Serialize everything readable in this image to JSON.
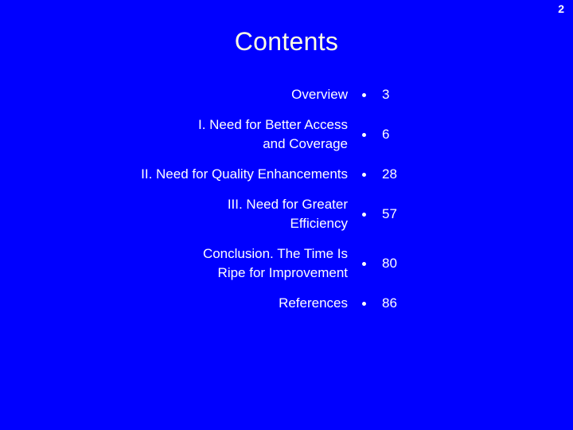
{
  "slide": {
    "number": "2",
    "title": "Contents",
    "background_color": "#0000FF",
    "title_color": "#FFFFE4",
    "text_color": "#FFFFFF"
  },
  "toc": {
    "entries": [
      {
        "label": "Overview",
        "page": "3",
        "lines": 1
      },
      {
        "label": "I. Need for Better Access and Coverage",
        "page": "6",
        "lines": 2
      },
      {
        "label": "II. Need for Quality Enhancements",
        "page": "28",
        "lines": 1
      },
      {
        "label": "III. Need for Greater Efficiency",
        "page": "57",
        "lines": 2
      },
      {
        "label": "Conclusion. The Time Is Ripe for Improvement",
        "page": "80",
        "lines": 2
      },
      {
        "label": "References",
        "page": "86",
        "lines": 1
      }
    ]
  }
}
